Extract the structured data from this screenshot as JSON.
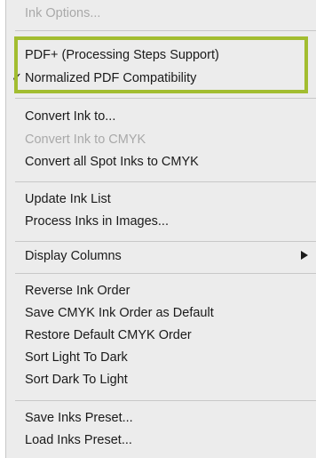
{
  "menu": {
    "ink_options": "Ink Options...",
    "pdf_plus": "PDF+ (Processing Steps Support)",
    "check_mark": "✓",
    "normalized_pdf": "Normalized PDF Compatibility",
    "convert_ink_to": "Convert Ink to...",
    "convert_ink_to_cmyk": "Convert Ink to CMYK",
    "convert_all_spot": "Convert all Spot Inks to CMYK",
    "update_ink_list": "Update Ink List",
    "process_inks_in_images": "Process Inks in Images...",
    "display_columns": "Display Columns",
    "reverse_ink_order": "Reverse Ink Order",
    "save_cmyk_order": "Save CMYK Ink Order as Default",
    "restore_default_cmyk": "Restore Default CMYK Order",
    "sort_light_to_dark": "Sort Light To Dark",
    "sort_dark_to_light": "Sort Dark To Light",
    "save_inks_preset": "Save Inks Preset...",
    "load_inks_preset": "Load Inks Preset..."
  },
  "colors": {
    "highlight_border": "#a2bd30",
    "menu_background": "#ececec",
    "disabled_text": "#a9a9a9"
  }
}
